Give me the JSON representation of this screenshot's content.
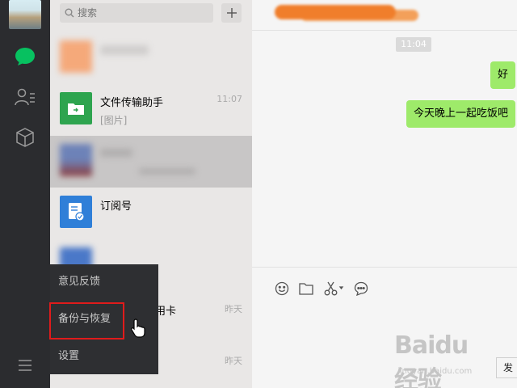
{
  "search": {
    "placeholder": "搜索"
  },
  "conversations": [
    {
      "name": "文件传输助手",
      "sub": "[图片]",
      "time": "11:07"
    },
    {
      "name": "订阅号"
    },
    {
      "name": "用卡",
      "time": "昨天"
    },
    {
      "time": "昨天"
    }
  ],
  "menu": {
    "items": [
      "意见反馈",
      "备份与恢复",
      "设置"
    ]
  },
  "chat": {
    "time_badge": "11:04",
    "messages": [
      "好",
      "今天晚上一起吃饭吧"
    ],
    "send_label": "发"
  },
  "watermark": {
    "main": "Baidu经验",
    "sub": "jingyan.baidu.com"
  },
  "colors": {
    "accent_green": "#07c160",
    "bubble_green": "#9eea6a",
    "rail_bg": "#2b2c2f",
    "highlight_red": "#e01b1b"
  }
}
